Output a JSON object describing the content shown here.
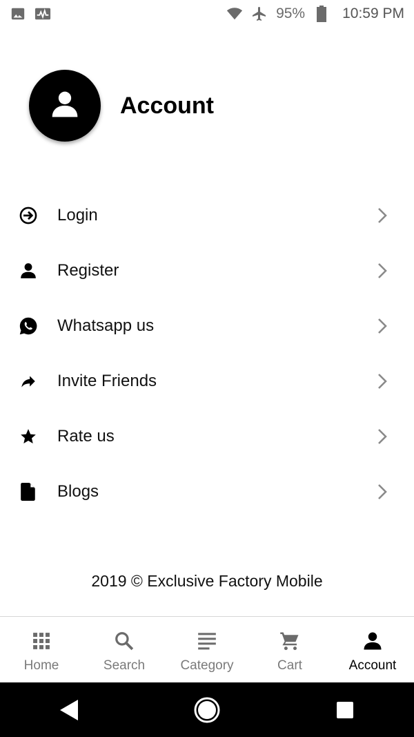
{
  "status_bar": {
    "battery": "95%",
    "time": "10:59 PM",
    "icons": [
      "image-icon",
      "activity-icon",
      "wifi-icon",
      "airplane-icon",
      "battery-icon"
    ]
  },
  "header": {
    "title": "Account",
    "avatar_icon": "person-icon"
  },
  "menu": {
    "items": [
      {
        "label": "Login",
        "icon": "login-icon"
      },
      {
        "label": "Register",
        "icon": "person-icon"
      },
      {
        "label": "Whatsapp us",
        "icon": "whatsapp-icon"
      },
      {
        "label": "Invite Friends",
        "icon": "share-icon"
      },
      {
        "label": "Rate us",
        "icon": "star-icon"
      },
      {
        "label": "Blogs",
        "icon": "document-icon"
      }
    ]
  },
  "footer": {
    "text": "2019 © Exclusive Factory Mobile"
  },
  "bottom_nav": {
    "items": [
      {
        "label": "Home",
        "icon": "grid-icon",
        "active": false
      },
      {
        "label": "Search",
        "icon": "search-icon",
        "active": false
      },
      {
        "label": "Category",
        "icon": "list-icon",
        "active": false
      },
      {
        "label": "Cart",
        "icon": "cart-icon",
        "active": false
      },
      {
        "label": "Account",
        "icon": "person-icon",
        "active": true
      }
    ]
  },
  "colors": {
    "background": "#ffffff",
    "text": "#111111",
    "inactive_nav": "#7a7a7a",
    "active_nav": "#000000",
    "chevron": "#8a8a8a"
  }
}
